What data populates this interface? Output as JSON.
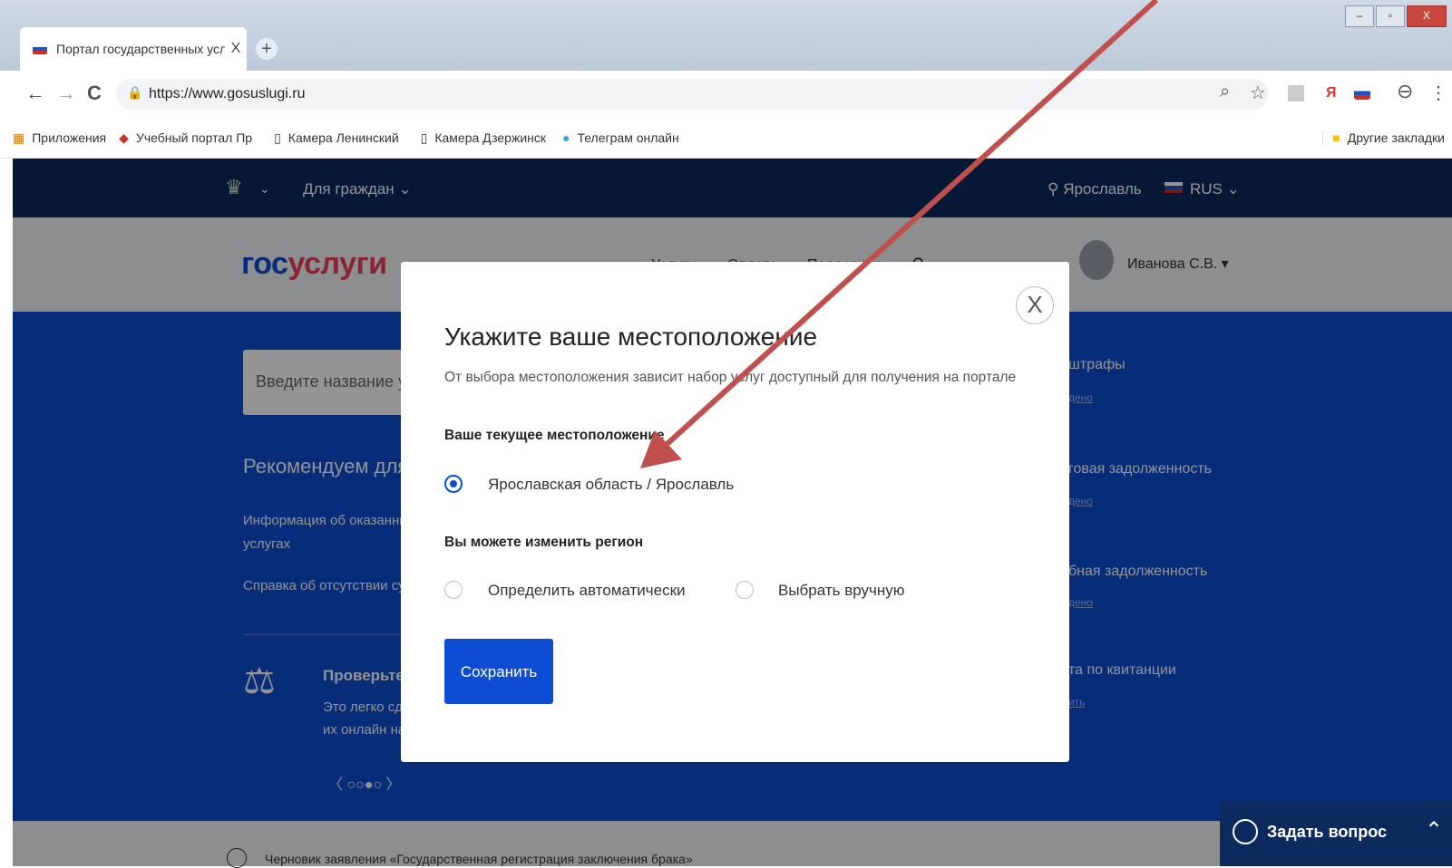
{
  "browser": {
    "tab_title": "Портал государственных услуг",
    "tab_close": "X",
    "new_tab": "+",
    "url": "https://www.gosuslugi.ru",
    "nav": {
      "back": "←",
      "forward": "→",
      "reload": "C"
    },
    "window": {
      "minimize": "–",
      "maximize": "▫",
      "close": "X"
    },
    "bookmarks": [
      "Приложения",
      "Учебный портал Пр",
      "Камера Ленинский",
      "Камера Дзержинск",
      "Телеграм онлайн"
    ],
    "other_bookmarks": "Другие закладки"
  },
  "topnav": {
    "audience": "Для граждан",
    "city": "Ярославль",
    "lang": "RUS"
  },
  "header": {
    "logo_part1": "гос",
    "logo_part2": "услуги",
    "nav_items": [
      "Услуги",
      "Оплата",
      "Поддержка"
    ],
    "user": "Иванова С.В."
  },
  "main": {
    "search_placeholder": "Введите название усл",
    "recommend_title": "Рекомендуем для ж",
    "recommend_items": [
      "Информация об оказанных",
      "услугах",
      "Справка об отсутствии суди"
    ],
    "promo_title": "Проверьте",
    "promo_text_1": "Это легко сде",
    "promo_text_2": "их онлайн на",
    "pager": "〈 ○○●○ 〉",
    "right_items": [
      {
        "title": "штрафы",
        "sub": "дено"
      },
      {
        "title": "говая задолженность",
        "sub": "дено"
      },
      {
        "title": "бная задолженность",
        "sub": "дено"
      },
      {
        "title": "та по квитанции",
        "sub": "ить"
      }
    ]
  },
  "modal": {
    "close": "X",
    "title": "Укажите ваше местоположение",
    "subtitle": "От выбора местоположения зависит набор услуг доступный для получения на портале",
    "current_heading": "Ваше текущее местоположение",
    "current_value": "Ярославская область / Ярославль",
    "change_heading": "Вы можете изменить регион",
    "option_auto": "Определить автоматически",
    "option_manual": "Выбрать вручную",
    "save": "Сохранить"
  },
  "chat": {
    "label": "Задать вопрос"
  },
  "footer": {
    "notice": "Черновик заявления «Государственная регистрация заключения брака»"
  },
  "colors": {
    "brand_blue": "#0d4cd3",
    "dark_nav": "#0d2a5e",
    "logo_red": "#ee3f58",
    "annotation_arrow": "#c0504d"
  }
}
